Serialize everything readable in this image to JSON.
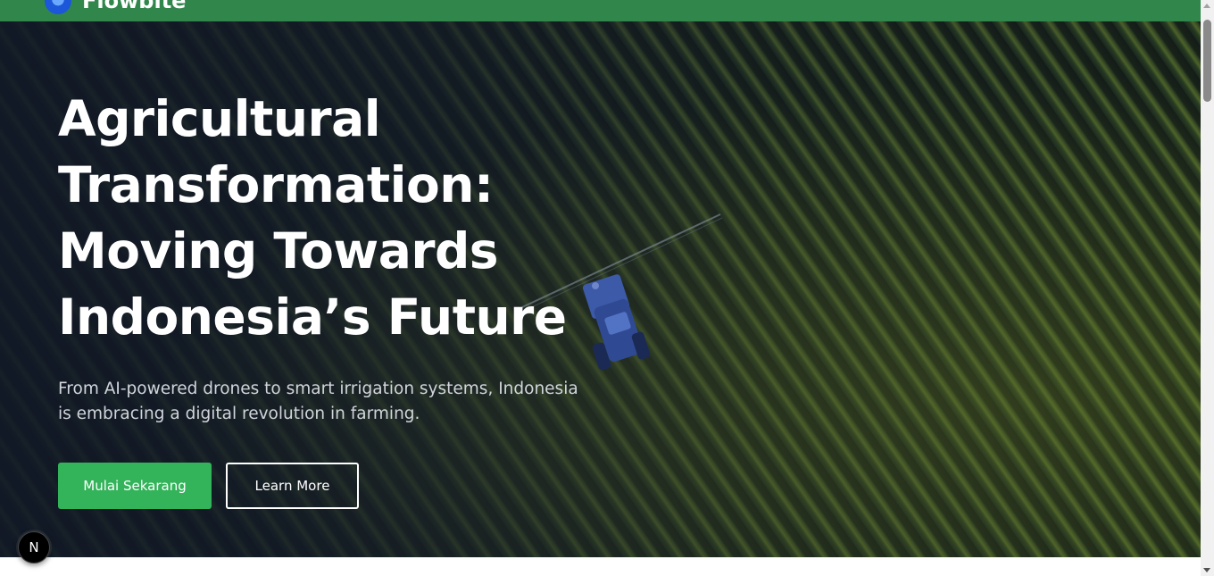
{
  "navbar": {
    "brand_name": "Flowbite",
    "logo_icon": "flowbite-logo-icon",
    "background_color": "#31864c"
  },
  "hero": {
    "title": "Agricultural Transformation: Moving Towards Indonesia’s Future",
    "subtitle": "From AI-powered drones to smart irrigation systems, Indonesia is embracing a digital revolution in farming.",
    "primary_button_label": "Mulai Sekarang",
    "secondary_button_label": "Learn More",
    "primary_button_color": "#33b35a",
    "background_image": "aerial-farm-field-with-tractor-image"
  },
  "floating_badge": {
    "label": "N",
    "icon": "nextjs-badge-icon"
  },
  "scrollbar": {
    "arrow_up_icon": "scroll-up-arrow-icon",
    "arrow_down_icon": "scroll-down-arrow-icon"
  }
}
